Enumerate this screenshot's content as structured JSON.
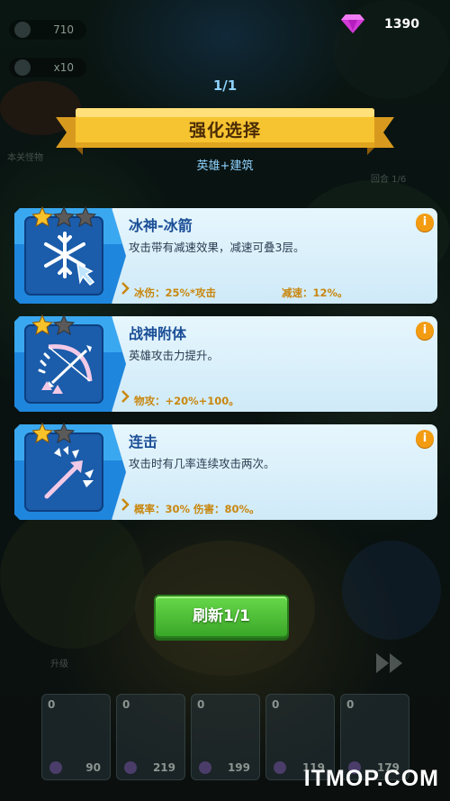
{
  "hud": {
    "gems": "1390",
    "top_left_value": "710",
    "speed_label": "x10",
    "side_label": "本关怪物",
    "round_label": "回合 1/6",
    "upgrade_label": "升级"
  },
  "selection": {
    "counter": "1/1",
    "title": "强化选择",
    "subtitle": "英雄+建筑"
  },
  "cards": [
    {
      "title": "冰神-冰箭",
      "desc": "攻击带有减速效果，减速可叠3层。",
      "stats": [
        "冰伤：25%*攻击",
        "减速：12%。"
      ],
      "stars_filled": 1,
      "stars_total": 3,
      "icon": "snowflake-arrow-icon"
    },
    {
      "title": "战神附体",
      "desc": "英雄攻击力提升。",
      "stats": [
        "物攻：+20%+100。"
      ],
      "stars_filled": 1,
      "stars_total": 2,
      "icon": "bow-icon"
    },
    {
      "title": "连击",
      "desc": "攻击时有几率连续攻击两次。",
      "stats": [
        "概率：30% 伤害：80%。"
      ],
      "stars_filled": 1,
      "stars_total": 2,
      "icon": "double-arrow-icon"
    }
  ],
  "refresh_button": "刷新1/1",
  "slots": [
    {
      "count": "0",
      "cost": "90"
    },
    {
      "count": "0",
      "cost": "219"
    },
    {
      "count": "0",
      "cost": "199"
    },
    {
      "count": "0",
      "cost": "119"
    },
    {
      "count": "0",
      "cost": "179"
    }
  ],
  "watermark": "ITMOP.COM",
  "colors": {
    "card_title": "#1a4e96",
    "stat_text": "#c9870f",
    "banner_gold": "#f7c431",
    "accent_blue": "#8fd3ff",
    "refresh_green": "#4cbf33"
  }
}
